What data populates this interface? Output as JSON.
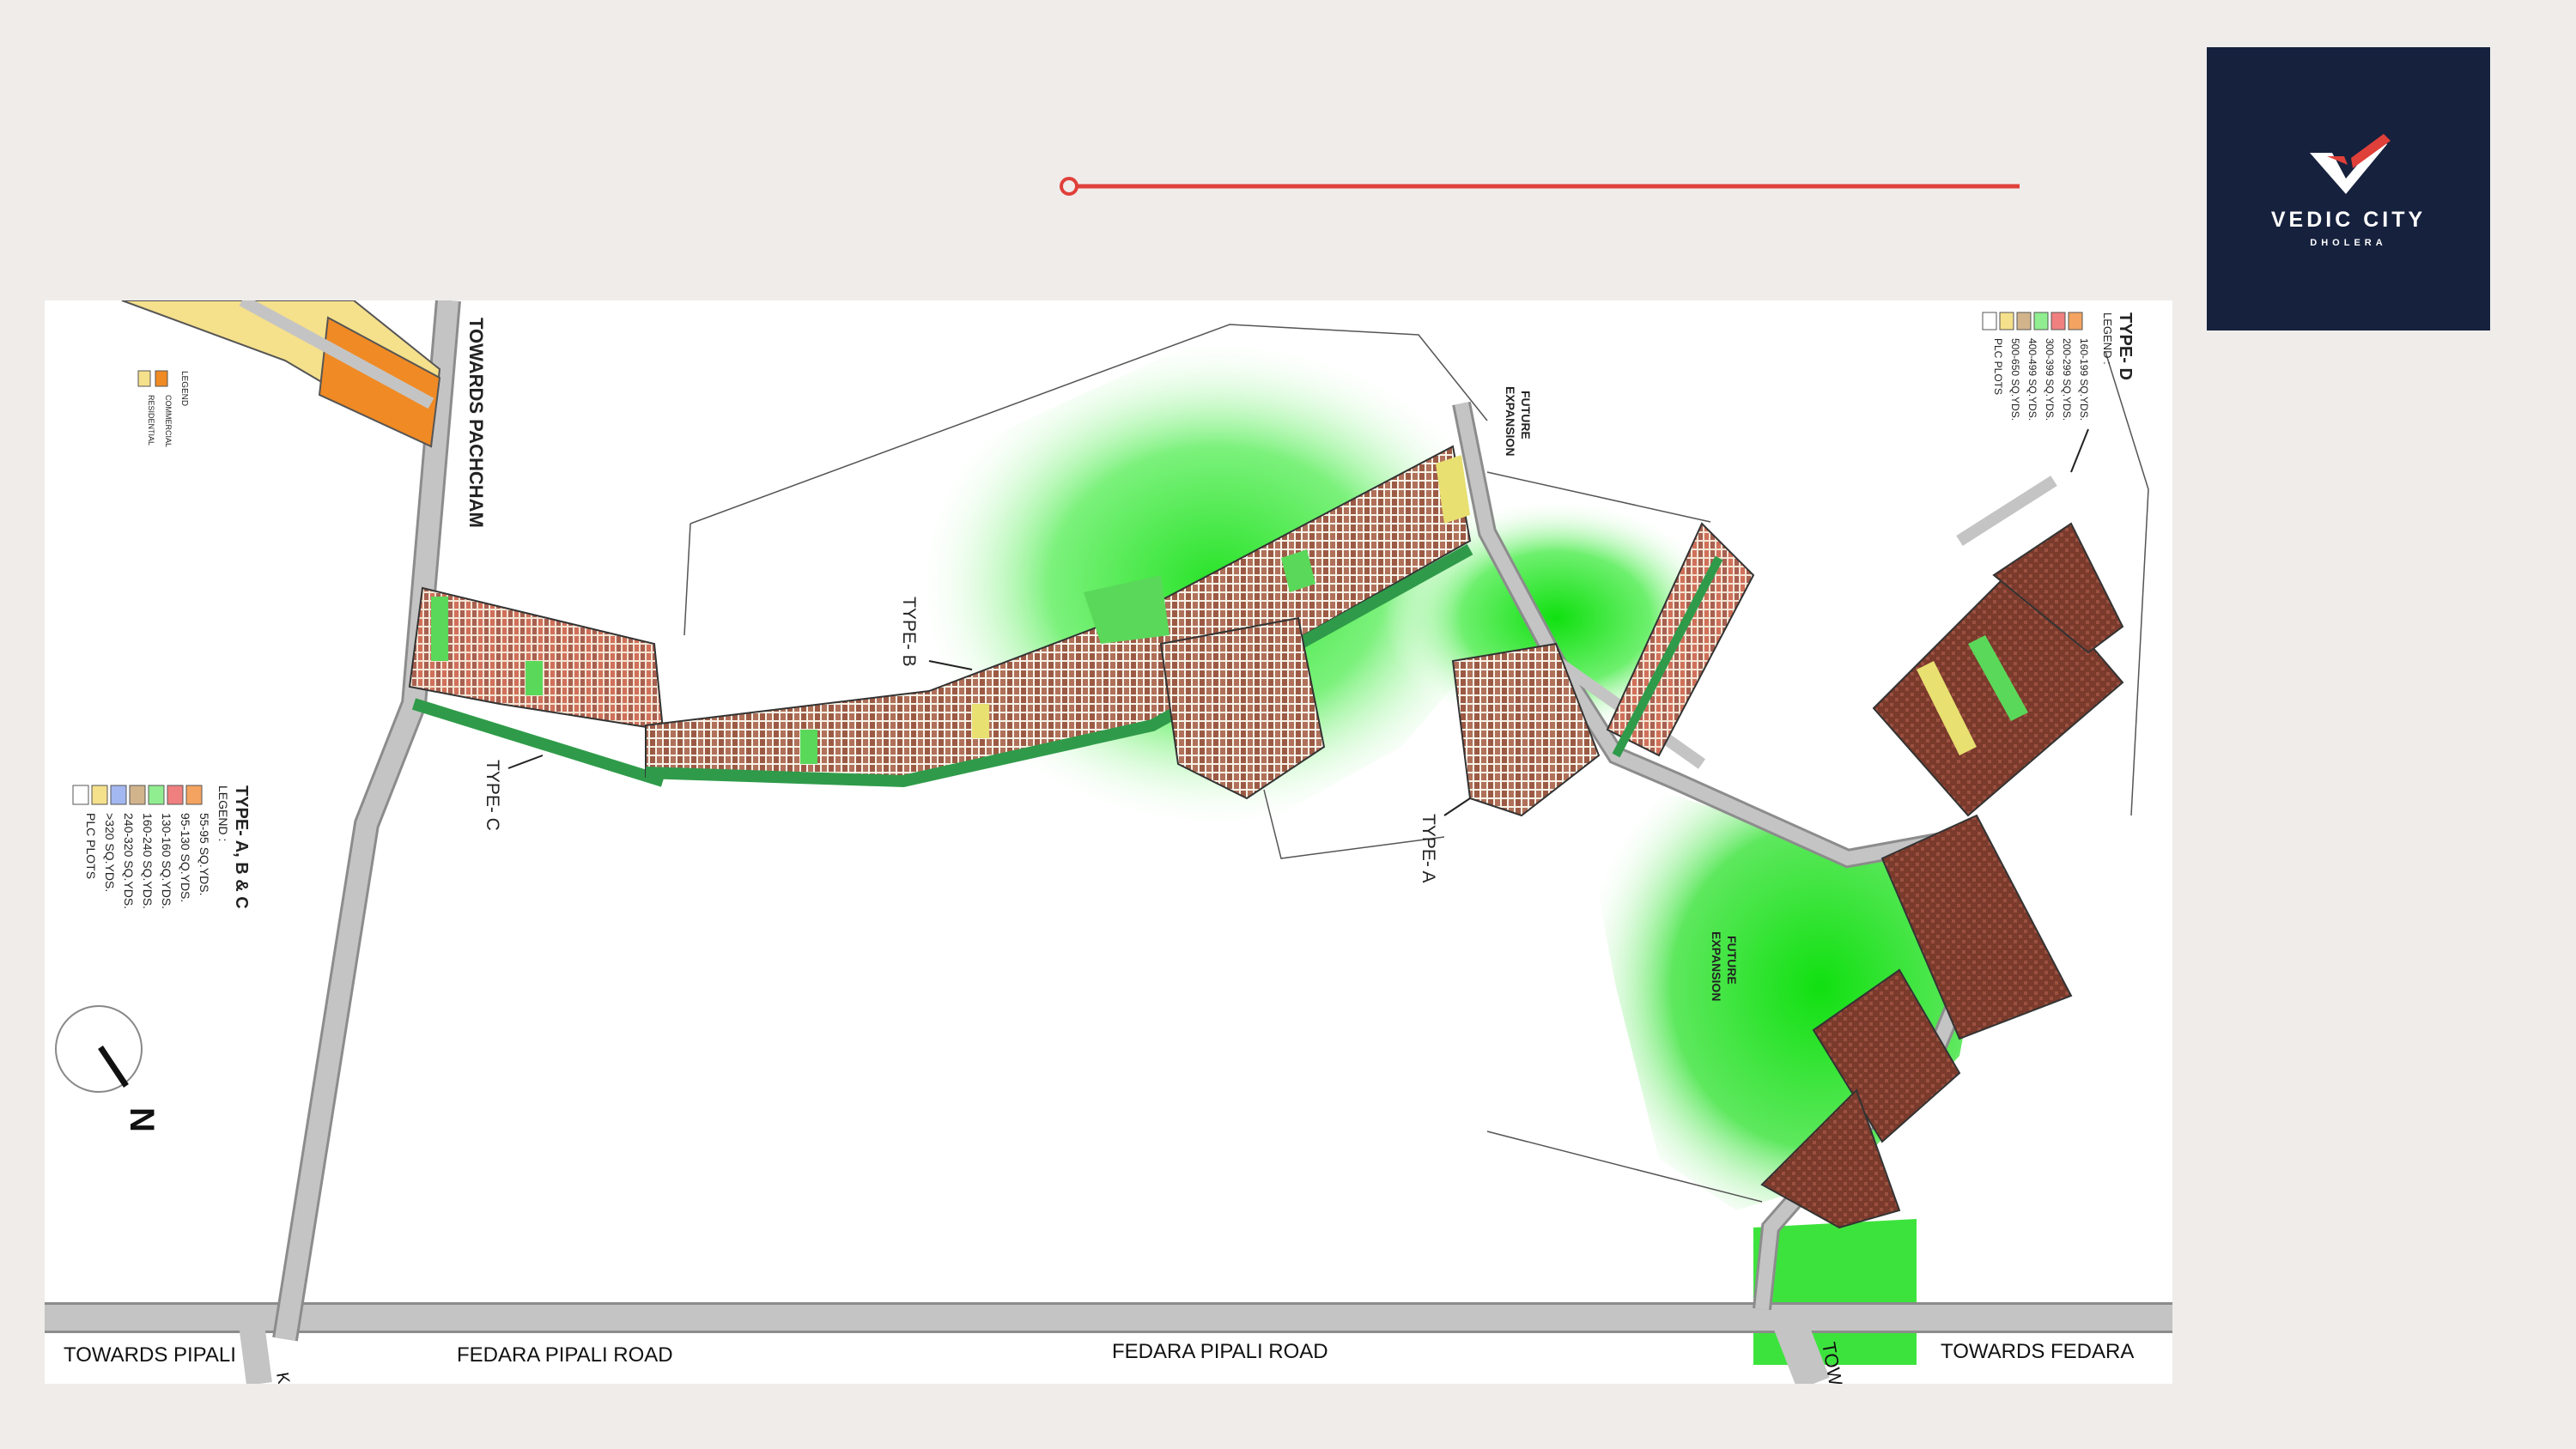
{
  "brand": {
    "name": "VEDIC CITY",
    "subtitle": "DHOLERA",
    "panel_color": "#16213e",
    "tick_color": "#e0403a"
  },
  "accent_color": "#e0403a",
  "map": {
    "road_labels": {
      "towards_pachcham": "TOWARDS PACHCHAM",
      "towards_pipali": "TOWARDS PIPALI",
      "fedara_pipali_1": "FEDARA PIPALI ROAD",
      "fedara_pipali_2": "FEDARA PIPALI ROAD",
      "towards_fedara": "TOWARDS FEDARA",
      "towards_cut": "TOW",
      "k_cut": "K"
    },
    "type_labels": {
      "type_a": "TYPE- A",
      "type_b": "TYPE- B",
      "type_c": "TYPE- C"
    },
    "future_expansion_1": [
      "FUTURE",
      "EXPANSION"
    ],
    "future_expansion_2": [
      "FUTURE",
      "EXPANSION"
    ],
    "north_label": "N",
    "legend_abc": {
      "title": "TYPE- A, B & C",
      "heading": "LEGEND :",
      "items": [
        {
          "label": "55-95 SQ.YDS.",
          "color": "#f4a460"
        },
        {
          "label": "95-130 SQ.YDS.",
          "color": "#f08080"
        },
        {
          "label": "130-160 SQ.YDS.",
          "color": "#90ee90"
        },
        {
          "label": "160-240 SQ.YDS.",
          "color": "#d2b48c"
        },
        {
          "label": "240-320 SQ.YDS.",
          "color": "#a3b8f0"
        },
        {
          "label": ">320 SQ.YDS.",
          "color": "#f5e08c"
        },
        {
          "label": "PLC PLOTS",
          "color": "#ffffff"
        }
      ]
    },
    "legend_d": {
      "title": "TYPE- D",
      "heading": "LEGEND :",
      "items": [
        {
          "label": "160-199 SQ.YDS.",
          "color": "#f4a460"
        },
        {
          "label": "200-299 SQ.YDS.",
          "color": "#f08080"
        },
        {
          "label": "300-399 SQ.YDS.",
          "color": "#90ee90"
        },
        {
          "label": "400-499 SQ.YDS.",
          "color": "#d2b48c"
        },
        {
          "label": "500-650 SQ.YDS.",
          "color": "#f5e08c"
        },
        {
          "label": "PLC PLOTS",
          "color": "#ffffff"
        }
      ]
    },
    "legend_top": {
      "heading": "LEGEND",
      "items": [
        {
          "label": "COMMERCIAL",
          "color": "#f08a24"
        },
        {
          "label": "RESIDENTIAL",
          "color": "#f5e08c"
        }
      ]
    },
    "colors": {
      "road": "#bdbdbd",
      "road_edge": "#8c8c8c",
      "green": "#22e022",
      "plot_brown": "#8b4a3a",
      "plot_red": "#e06a50",
      "plot_green": "#2f9b4a",
      "plot_yellow": "#e8e070"
    }
  }
}
